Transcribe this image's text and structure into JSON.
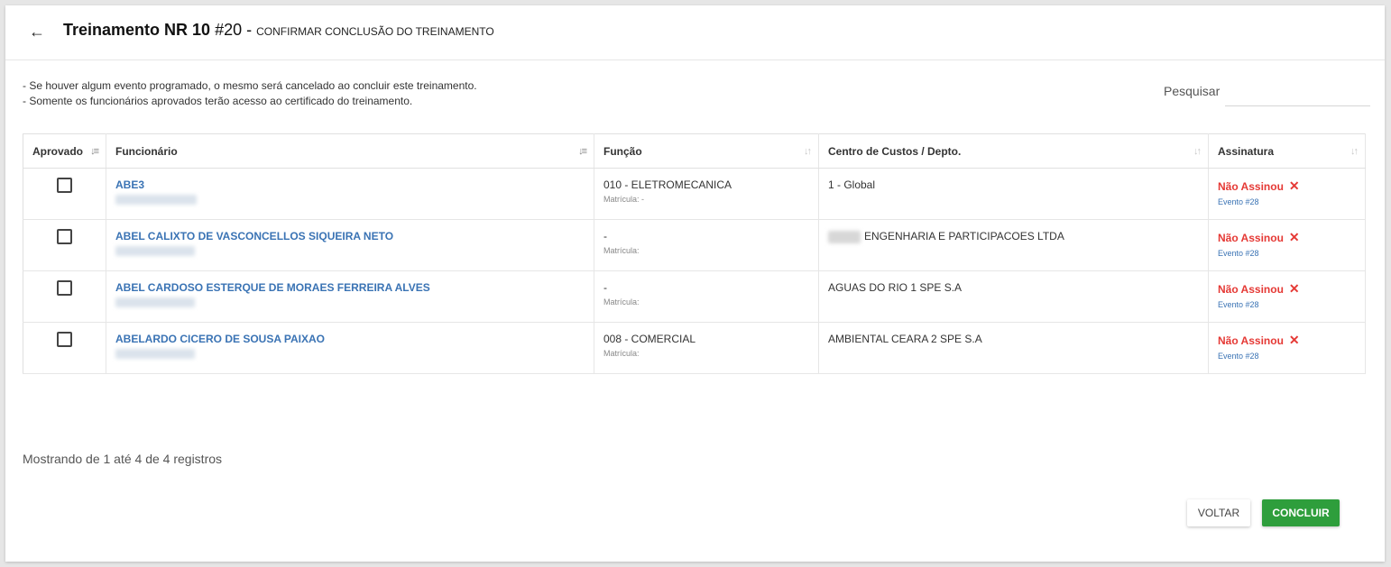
{
  "header": {
    "title": "Treinamento NR 10",
    "number": "#20",
    "separator": "-",
    "subtitle": "CONFIRMAR CONCLUSÃO DO TREINAMENTO",
    "back_icon": "arrow-left-icon"
  },
  "notes": [
    "- Se houver algum evento programado, o mesmo será cancelado ao concluir este treinamento.",
    "- Somente os funcionários aprovados terão acesso ao certificado do treinamento."
  ],
  "search": {
    "label": "Pesquisar",
    "value": ""
  },
  "table": {
    "columns": [
      "Aprovado",
      "Funcionário",
      "Função",
      "Centro de Custos / Depto.",
      "Assinatura"
    ],
    "rows": [
      {
        "approved": false,
        "employee": "ABE3",
        "function": "010 - ELETROMECANICA",
        "registration": "Matrícula: -",
        "cost_center": "1 - Global",
        "signature": "Não Assinou",
        "event": "Evento #28"
      },
      {
        "approved": false,
        "employee": "ABEL CALIXTO DE VASCONCELLOS SIQUEIRA NETO",
        "function": "-",
        "registration": "Matrícula:",
        "cost_center": "ENGENHARIA E PARTICIPACOES LTDA",
        "signature": "Não Assinou",
        "event": "Evento #28"
      },
      {
        "approved": false,
        "employee": "ABEL CARDOSO ESTERQUE DE MORAES FERREIRA ALVES",
        "function": "-",
        "registration": "Matrícula:",
        "cost_center": "AGUAS DO RIO 1 SPE S.A",
        "signature": "Não Assinou",
        "event": "Evento #28"
      },
      {
        "approved": false,
        "employee": "ABELARDO CICERO DE SOUSA PAIXAO",
        "function": "008 - COMERCIAL",
        "registration": "Matrícula:",
        "cost_center": "AMBIENTAL CEARA 2 SPE S.A",
        "signature": "Não Assinou",
        "event": "Evento #28"
      }
    ]
  },
  "footer": {
    "info": "Mostrando de 1 até 4 de 4 registros"
  },
  "buttons": {
    "back": "VOLTAR",
    "confirm": "CONCLUIR"
  },
  "colors": {
    "link": "#3a73b4",
    "danger": "#e53935",
    "success": "#2e9e3c"
  }
}
